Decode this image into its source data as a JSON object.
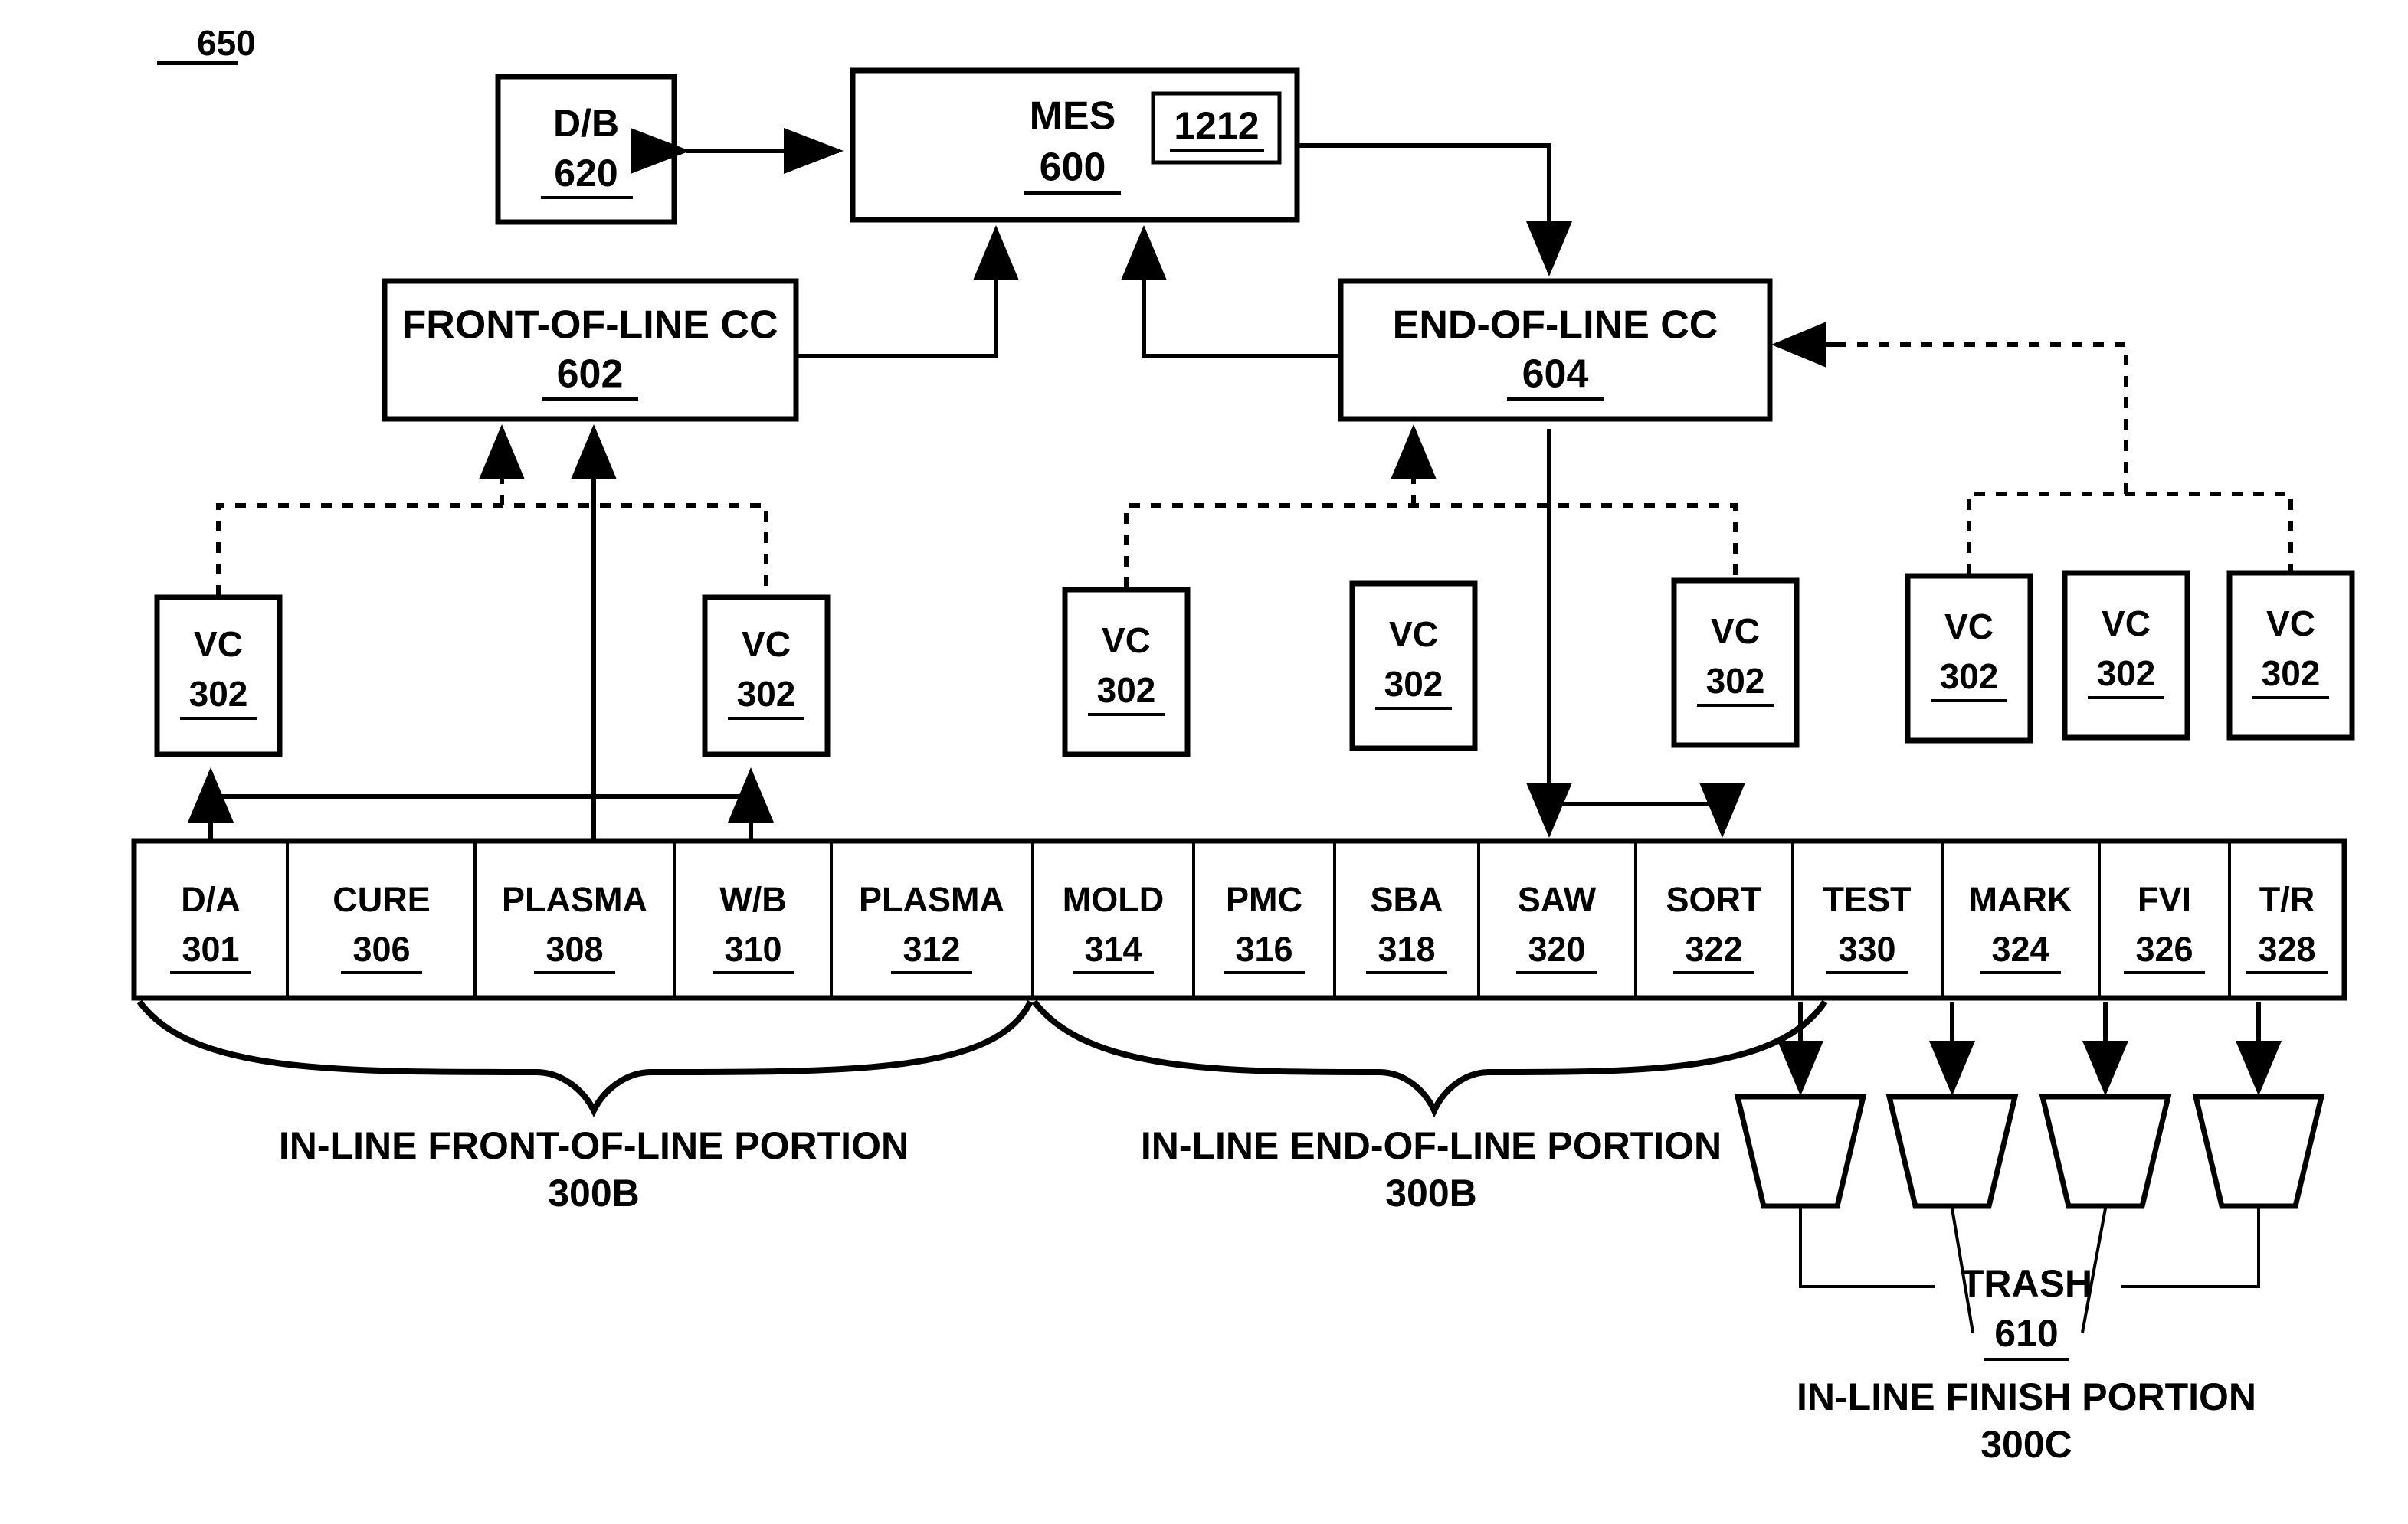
{
  "figure": {
    "number": "650"
  },
  "nodes": {
    "db": {
      "label": "D/B",
      "ref": "620"
    },
    "mes": {
      "label": "MES",
      "ref": "600",
      "inset_ref": "1212"
    },
    "fol_cc": {
      "label": "FRONT-OF-LINE CC",
      "ref": "602"
    },
    "eol_cc": {
      "label": "END-OF-LINE CC",
      "ref": "604"
    }
  },
  "vision_controllers": [
    {
      "label": "VC",
      "ref": "302",
      "group": "front-of-line"
    },
    {
      "label": "VC",
      "ref": "302",
      "group": "front-of-line"
    },
    {
      "label": "VC",
      "ref": "302",
      "group": "end-of-line"
    },
    {
      "label": "VC",
      "ref": "302",
      "group": "end-of-line"
    },
    {
      "label": "VC",
      "ref": "302",
      "group": "end-of-line"
    },
    {
      "label": "VC",
      "ref": "302",
      "group": "finish"
    },
    {
      "label": "VC",
      "ref": "302",
      "group": "finish"
    },
    {
      "label": "VC",
      "ref": "302",
      "group": "finish"
    }
  ],
  "stations": [
    {
      "label": "D/A",
      "ref": "301"
    },
    {
      "label": "CURE",
      "ref": "306"
    },
    {
      "label": "PLASMA",
      "ref": "308"
    },
    {
      "label": "W/B",
      "ref": "310"
    },
    {
      "label": "PLASMA",
      "ref": "312"
    },
    {
      "label": "MOLD",
      "ref": "314"
    },
    {
      "label": "PMC",
      "ref": "316"
    },
    {
      "label": "SBA",
      "ref": "318"
    },
    {
      "label": "SAW",
      "ref": "320"
    },
    {
      "label": "SORT",
      "ref": "322"
    },
    {
      "label": "TEST",
      "ref": "330"
    },
    {
      "label": "MARK",
      "ref": "324"
    },
    {
      "label": "FVI",
      "ref": "326"
    },
    {
      "label": "T/R",
      "ref": "328"
    }
  ],
  "captions": {
    "front_portion_line1": "IN-LINE FRONT-OF-LINE PORTION",
    "front_portion_line2": "300B",
    "end_portion_line1": "IN-LINE END-OF-LINE PORTION",
    "end_portion_line2": "300B",
    "trash_label": "TRASH",
    "trash_ref": "610",
    "finish_portion_line1": "IN-LINE FINISH PORTION",
    "finish_portion_line2": "300C"
  },
  "colors": {
    "ink": "#000000",
    "paper": "#ffffff"
  }
}
